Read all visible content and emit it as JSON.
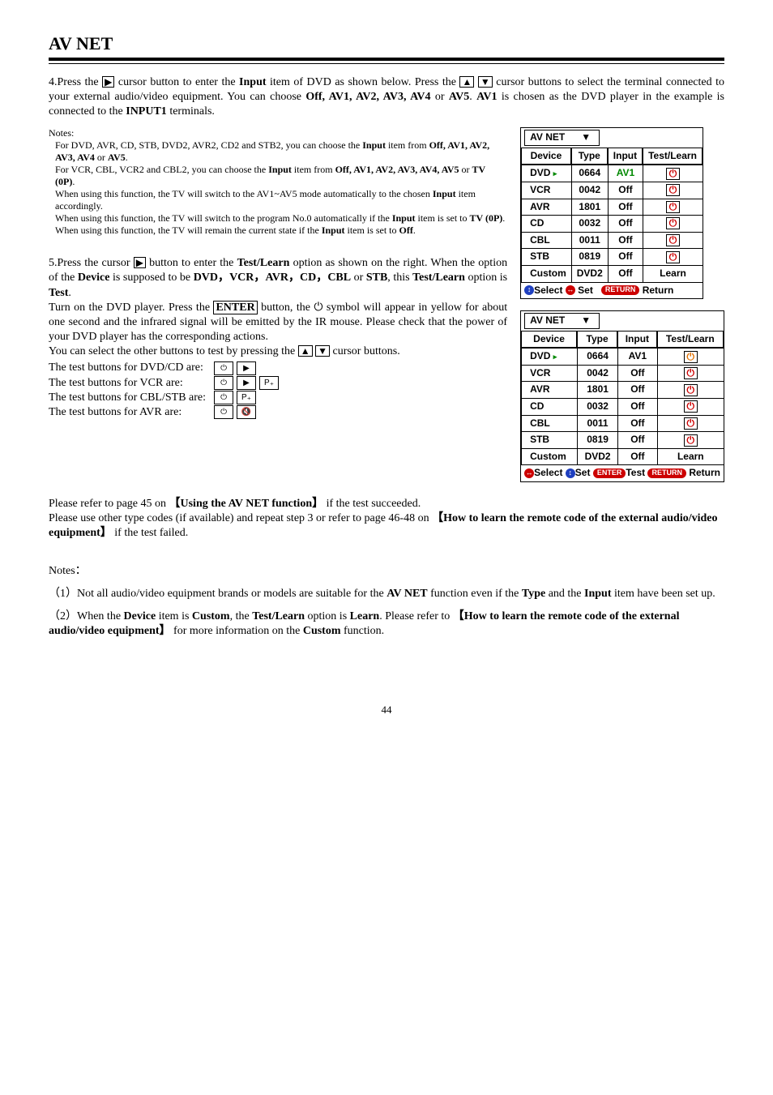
{
  "title": "AV NET",
  "step4": {
    "prefix": "4.Press the ",
    "mid1": " cursor button to enter the ",
    "inputWord": "Input",
    "mid2": " item of DVD as shown below. Press the ",
    "mid3": " cursor buttons to select the terminal connected to your external audio/video equipment. You can choose ",
    "offavs": "Off, AV1, AV2, AV3, AV4",
    "orWord": " or ",
    "av5": "AV5",
    "sentence2a": ". ",
    "av1bold": "AV1",
    "sentence2b": " is chosen as the DVD player in the example is connected to the ",
    "input1": "INPUT1",
    "sentence2c": " terminals."
  },
  "notesLabel": "Notes:",
  "notes": {
    "l1a": "For DVD, AVR, CD, STB, DVD2, AVR2, CD2 and STB2, you can choose the ",
    "l1input": "Input",
    "l1b": " item from ",
    "l1list": "Off, AV1, AV2, AV3, AV4",
    "l1or": " or ",
    "l1av5": "AV5",
    "l1end": ".",
    "l2a": "For VCR, CBL, VCR2 and CBL2, you can choose the ",
    "l2input": "Input",
    "l2b": " item from ",
    "l2list": "Off, AV1, AV2, AV3, AV4, AV5",
    "l2or": " or ",
    "l2tv": "TV (0P)",
    "l2end": ".",
    "l3a": "When using this function, the TV will switch to the AV1~AV5 mode automatically to the chosen ",
    "l3input": "Input",
    "l3b": " item accordingly.",
    "l4a": "When using this function, the TV will switch to the program No.0 automatically if the ",
    "l4input": "Input",
    "l4b": " item is set to ",
    "l4tv": "TV (0P)",
    "l4end": ".",
    "l5a": "When using this function, the TV will remain the current state if the ",
    "l5input": "Input",
    "l5b": " item is set to ",
    "l5off": "Off",
    "l5end": "."
  },
  "step5": {
    "prefix": "5.Press the cursor ",
    "a": " button to enter the ",
    "testlearn": "Test/Learn",
    "b": " option as shown on the right. When the option of the ",
    "device": "Device",
    "c": " is supposed to be ",
    "list": "DVD，VCR，AVR，CD，CBL",
    "or": " or ",
    "stb": "STB",
    "d": ", this ",
    "testlearn2": "Test/Learn",
    "e": " option is ",
    "test": "Test",
    "f": ".",
    "line2a": "Turn on the DVD player. Press the ",
    "enter": "ENTER",
    "line2b": " button, the ",
    "line2c": " symbol will appear in yellow for about one second and the infrared signal will be emitted by the IR mouse. Please check that the power of your DVD player has the corresponding actions.",
    "line3a": "You can select the other buttons to test by pressing the ",
    "line3b": " cursor buttons.",
    "bt1": "The test buttons for DVD/CD are:",
    "bt2": "The test buttons for VCR are:",
    "bt3": "The test buttons for CBL/STB are:",
    "bt4": "The test buttons for AVR are:"
  },
  "after": {
    "p1a": "Please refer to page 45 on ",
    "p1b": "【Using the AV NET function】",
    "p1c": " if the test succeeded.",
    "p2a": "Please use other type codes (if available) and repeat step 3 or refer to page 46-48 on ",
    "p2b": "【How to learn the remote code of the external audio/video equipment】",
    "p2c": " if the test failed."
  },
  "notes2Label": "Notes：",
  "notes2": {
    "n1a": "（1）Not all audio/video equipment brands or models are suitable for the ",
    "n1b": "AV NET",
    "n1c": " function even if the ",
    "n1d": "Type",
    "n1e": " and the ",
    "n1f": "Input",
    "n1g": " item have been set up.",
    "n2a": "（2）When the ",
    "n2b": "Device",
    "n2c": " item is ",
    "n2d": "Custom",
    "n2e": ", the ",
    "n2f": "Test/Learn",
    "n2g": " option is ",
    "n2h": "Learn",
    "n2i": ". Please refer to ",
    "n2j": "【How to learn the remote code of the external audio/video equipment】",
    "n2k": " for more information on the ",
    "n2l": "Custom",
    "n2m": " function."
  },
  "table": {
    "tab": "AV NET",
    "h1": "Device",
    "h2": "Type",
    "h3": "Input",
    "h4": "Test/Learn",
    "rows": [
      {
        "d": "DVD",
        "t": "0664",
        "i": "AV1",
        "green": true
      },
      {
        "d": "VCR",
        "t": "0042",
        "i": "Off"
      },
      {
        "d": "AVR",
        "t": "1801",
        "i": "Off"
      },
      {
        "d": "CD",
        "t": "0032",
        "i": "Off"
      },
      {
        "d": "CBL",
        "t": "0011",
        "i": "Off"
      },
      {
        "d": "STB",
        "t": "0819",
        "i": "Off"
      },
      {
        "d": "Custom",
        "t": "DVD2",
        "i": "Off",
        "learn": "Learn"
      }
    ],
    "foot1": {
      "select": "Select",
      "set": "Set",
      "return": "Return",
      "pill": "RETURN"
    },
    "foot2": {
      "select": "Select",
      "set": "Set",
      "test": "Test",
      "return": "Return",
      "pillE": "ENTER",
      "pillR": "RETURN"
    }
  },
  "pageNo": "44"
}
